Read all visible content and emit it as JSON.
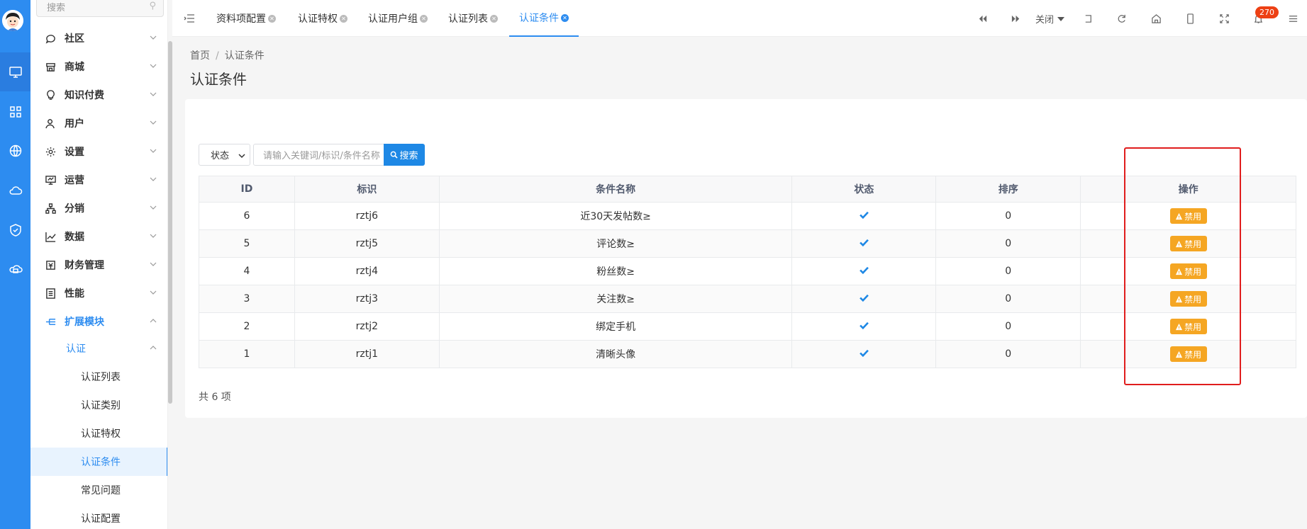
{
  "sidebar": {
    "search_placeholder": "搜索",
    "menus": [
      {
        "label": "社区",
        "icon": "chat-icon"
      },
      {
        "label": "商城",
        "icon": "store-icon"
      },
      {
        "label": "知识付费",
        "icon": "lightbulb-icon"
      },
      {
        "label": "用户",
        "icon": "user-icon"
      },
      {
        "label": "设置",
        "icon": "gear-icon"
      },
      {
        "label": "运营",
        "icon": "monitor-icon"
      },
      {
        "label": "分销",
        "icon": "hierarchy-icon"
      },
      {
        "label": "数据",
        "icon": "line-chart-icon"
      },
      {
        "label": "财务管理",
        "icon": "finance-icon"
      },
      {
        "label": "性能",
        "icon": "performance-icon"
      },
      {
        "label": "扩展模块",
        "icon": "extension-icon"
      }
    ],
    "submenu": {
      "label": "认证"
    },
    "leaves": [
      "认证列表",
      "认证类别",
      "认证特权",
      "认证条件",
      "常见问题",
      "认证配置"
    ],
    "active_leaf": "认证条件"
  },
  "tabs": [
    {
      "label": "资料项配置"
    },
    {
      "label": "认证特权"
    },
    {
      "label": "认证用户组"
    },
    {
      "label": "认证列表"
    },
    {
      "label": "认证条件",
      "active": true
    }
  ],
  "topbar": {
    "close_label": "关闭",
    "notification_count": "270"
  },
  "breadcrumb": {
    "home": "首页",
    "current": "认证条件"
  },
  "page_title": "认证条件",
  "filter": {
    "status_label": "状态",
    "search_placeholder": "请输入关键词/标识/条件名称",
    "search_button": "搜索"
  },
  "table": {
    "headers": {
      "id": "ID",
      "tag": "标识",
      "name": "条件名称",
      "status": "状态",
      "sort": "排序",
      "ops": "操作"
    },
    "rows": [
      {
        "id": "6",
        "tag": "rztj6",
        "name": "近30天发帖数≥",
        "status": "enabled",
        "sort": "0",
        "action": "禁用"
      },
      {
        "id": "5",
        "tag": "rztj5",
        "name": "评论数≥",
        "status": "enabled",
        "sort": "0",
        "action": "禁用"
      },
      {
        "id": "4",
        "tag": "rztj4",
        "name": "粉丝数≥",
        "status": "enabled",
        "sort": "0",
        "action": "禁用"
      },
      {
        "id": "3",
        "tag": "rztj3",
        "name": "关注数≥",
        "status": "enabled",
        "sort": "0",
        "action": "禁用"
      },
      {
        "id": "2",
        "tag": "rztj2",
        "name": "绑定手机",
        "status": "enabled",
        "sort": "0",
        "action": "禁用"
      },
      {
        "id": "1",
        "tag": "rztj1",
        "name": "清晰头像",
        "status": "enabled",
        "sort": "0",
        "action": "禁用"
      }
    ]
  },
  "total_text": "共 6 项",
  "colors": {
    "primary": "#2d8cf0",
    "warning": "#f5a623",
    "highlight": "#e01d1d",
    "badge": "#ed4014"
  }
}
